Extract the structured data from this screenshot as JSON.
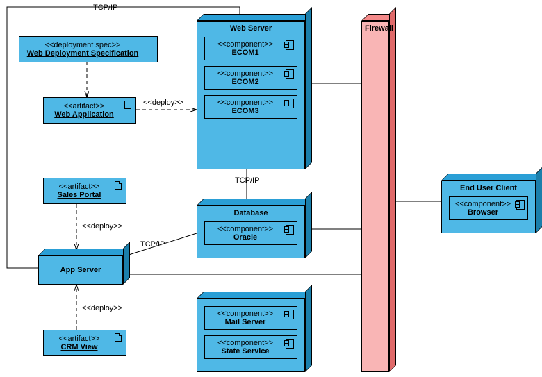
{
  "labels": {
    "tcpip": "TCP/IP",
    "deploy": "<<deploy>>"
  },
  "webDeploySpec": {
    "stereo": "<<deployment spec>>",
    "name": "Web Deployment Specification"
  },
  "webApp": {
    "stereo": "<<artifact>>",
    "name": "Web Application"
  },
  "salesPortal": {
    "stereo": "<<artifact>>",
    "name": "Sales Portal"
  },
  "crmView": {
    "stereo": "<<artifact>>",
    "name": "CRM View"
  },
  "appServer": {
    "title": "App Server"
  },
  "webServer": {
    "title": "Web Server",
    "components": [
      {
        "stereo": "<<component>>",
        "name": "ECOM1"
      },
      {
        "stereo": "<<component>>",
        "name": "ECOM2"
      },
      {
        "stereo": "<<component>>",
        "name": "ECOM3"
      }
    ]
  },
  "database": {
    "title": "Database",
    "components": [
      {
        "stereo": "<<component>>",
        "name": "Oracle"
      }
    ]
  },
  "servicesNode": {
    "title": "",
    "components": [
      {
        "stereo": "<<component>>",
        "name": "Mail Server"
      },
      {
        "stereo": "<<component>>",
        "name": "State Service"
      }
    ]
  },
  "firewall": {
    "title": "Firewall"
  },
  "endUser": {
    "title": "End User Client",
    "components": [
      {
        "stereo": "<<component>>",
        "name": "Browser"
      }
    ]
  }
}
